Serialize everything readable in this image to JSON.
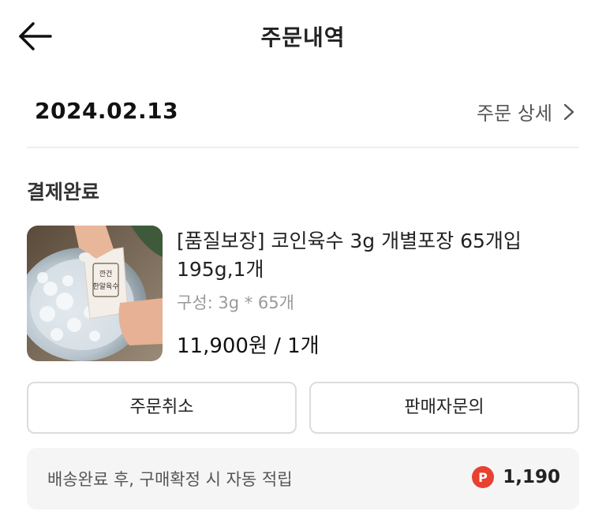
{
  "header": {
    "title": "주문내역"
  },
  "order": {
    "date": "2024.02.13",
    "detail_link": "주문 상세",
    "status": "결제완료"
  },
  "product": {
    "name": "[품질보장] 코인육수 3g 개별포장 65개입 195g,1개",
    "option": "구성: 3g * 65개",
    "price_qty": "11,900원 / 1개",
    "thumb_label": "[깐건]\n한알육수"
  },
  "actions": {
    "cancel": "주문취소",
    "inquiry": "판매자문의"
  },
  "points": {
    "text": "배송완료 후, 구매확정 시 자동 적립",
    "value": "1,190",
    "icon_letter": "P"
  },
  "colors": {
    "accent_points": "#e8412f",
    "divider": "#eeeeee",
    "muted_text": "#9a9a9a"
  }
}
